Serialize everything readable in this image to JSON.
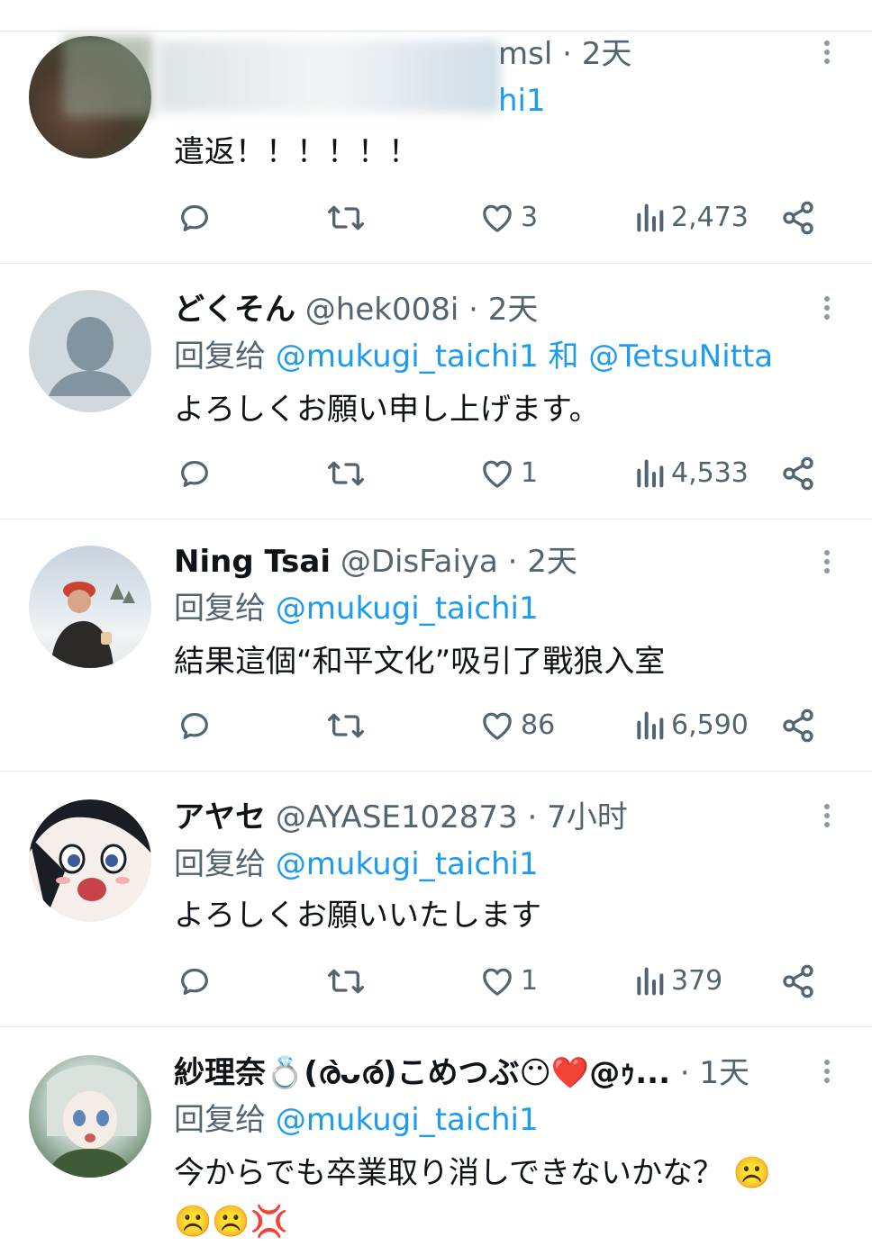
{
  "tweets": [
    {
      "name": "",
      "handle_tail": "msl",
      "dot": "·",
      "time": "2天",
      "reply_prefix": "",
      "reply_tail": "hi1",
      "text": "遣返！！！！！！",
      "reply_count": "",
      "retweet_count": "",
      "like_count": "3",
      "views": "2,473"
    },
    {
      "name": "どくそん",
      "handle": "@hek008i",
      "dot": "·",
      "time": "2天",
      "reply_prefix": "回复给",
      "mentions": [
        "@mukugi_taichi1",
        "和",
        "@TetsuNitta"
      ],
      "text": "よろしくお願い申し上げます。",
      "like_count": "1",
      "views": "4,533"
    },
    {
      "name": "Ning Tsai",
      "handle": "@DisFaiya",
      "dot": "·",
      "time": "2天",
      "reply_prefix": "回复给",
      "mentions": [
        "@mukugi_taichi1"
      ],
      "text": "結果這個“和平文化”吸引了戰狼入室",
      "like_count": "86",
      "views": "6,590"
    },
    {
      "name": "アヤセ",
      "handle": "@AYASE102873",
      "dot": "·",
      "time": "7小时",
      "reply_prefix": "回复给",
      "mentions": [
        "@mukugi_taichi1"
      ],
      "text": "よろしくお願いいたします",
      "like_count": "1",
      "views": "379"
    },
    {
      "name": "紗理奈💍(ര̀ᴗര́)こめつぶ😶❤️@ｩ...",
      "handle": "",
      "dot": "·",
      "time": "1天",
      "reply_prefix": "回复给",
      "mentions": [
        "@mukugi_taichi1"
      ],
      "text": "今からでも卒業取り消しできないかな？ ☹️",
      "text_line2": "☹️☹️💢"
    }
  ],
  "colors": {
    "accent": "#1d9bf0",
    "secondary_text": "#536471",
    "divider": "#e6e9ea"
  },
  "icons": [
    "reply-icon",
    "retweet-icon",
    "like-icon",
    "views-icon",
    "share-icon",
    "more-icon"
  ]
}
